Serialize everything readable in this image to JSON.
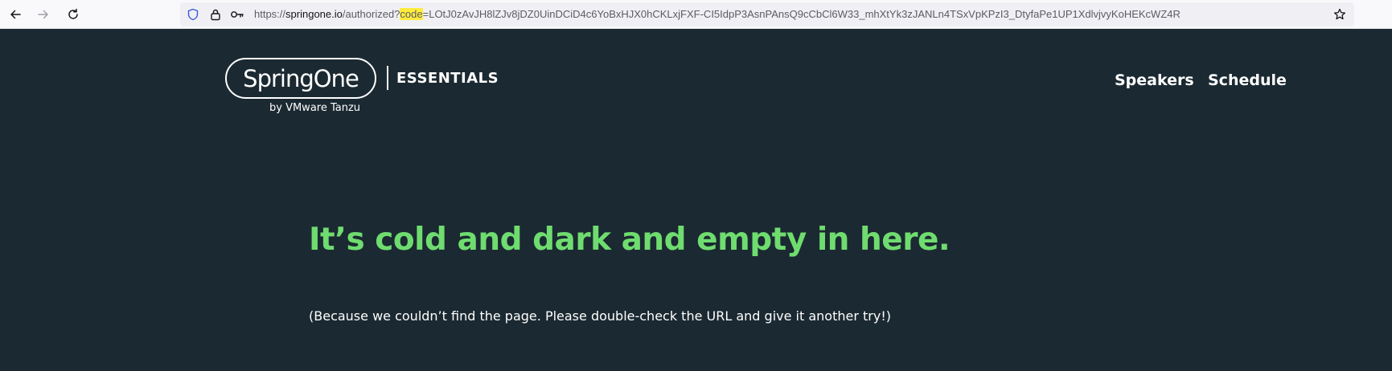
{
  "browser": {
    "url_prefix": "https://",
    "url_host": "springone.io",
    "url_path": "/authorized?",
    "url_highlight": "code",
    "url_rest": "=LOtJ0zAvJH8lZJv8jDZ0UinDCiD4c6YoBxHJX0hCKLxjFXF-CI5IdpP3AsnPAnsQ9cCbCl6W33_mhXtYk3zJANLn4TSxVpKPzI3_DtyfaPe1UP1XdlvjvyKoHEKcWZ4R",
    "icons": [
      "back-arrow-icon",
      "forward-arrow-icon",
      "reload-icon",
      "shield-icon",
      "lock-icon",
      "key-icon",
      "star-icon"
    ]
  },
  "header": {
    "logo_name": "SpringOne",
    "logo_sub": "ESSENTIALS",
    "logo_by": "by VMware Tanzu",
    "nav": [
      {
        "label": "Speakers"
      },
      {
        "label": "Schedule"
      }
    ]
  },
  "main": {
    "headline": "It’s cold and dark and empty in here.",
    "message": "(Because we couldn’t find the page. Please double-check the URL and give it another try!)"
  },
  "colors": {
    "background": "#1b2932",
    "accent": "#6fdc6f",
    "text": "#ffffff"
  }
}
